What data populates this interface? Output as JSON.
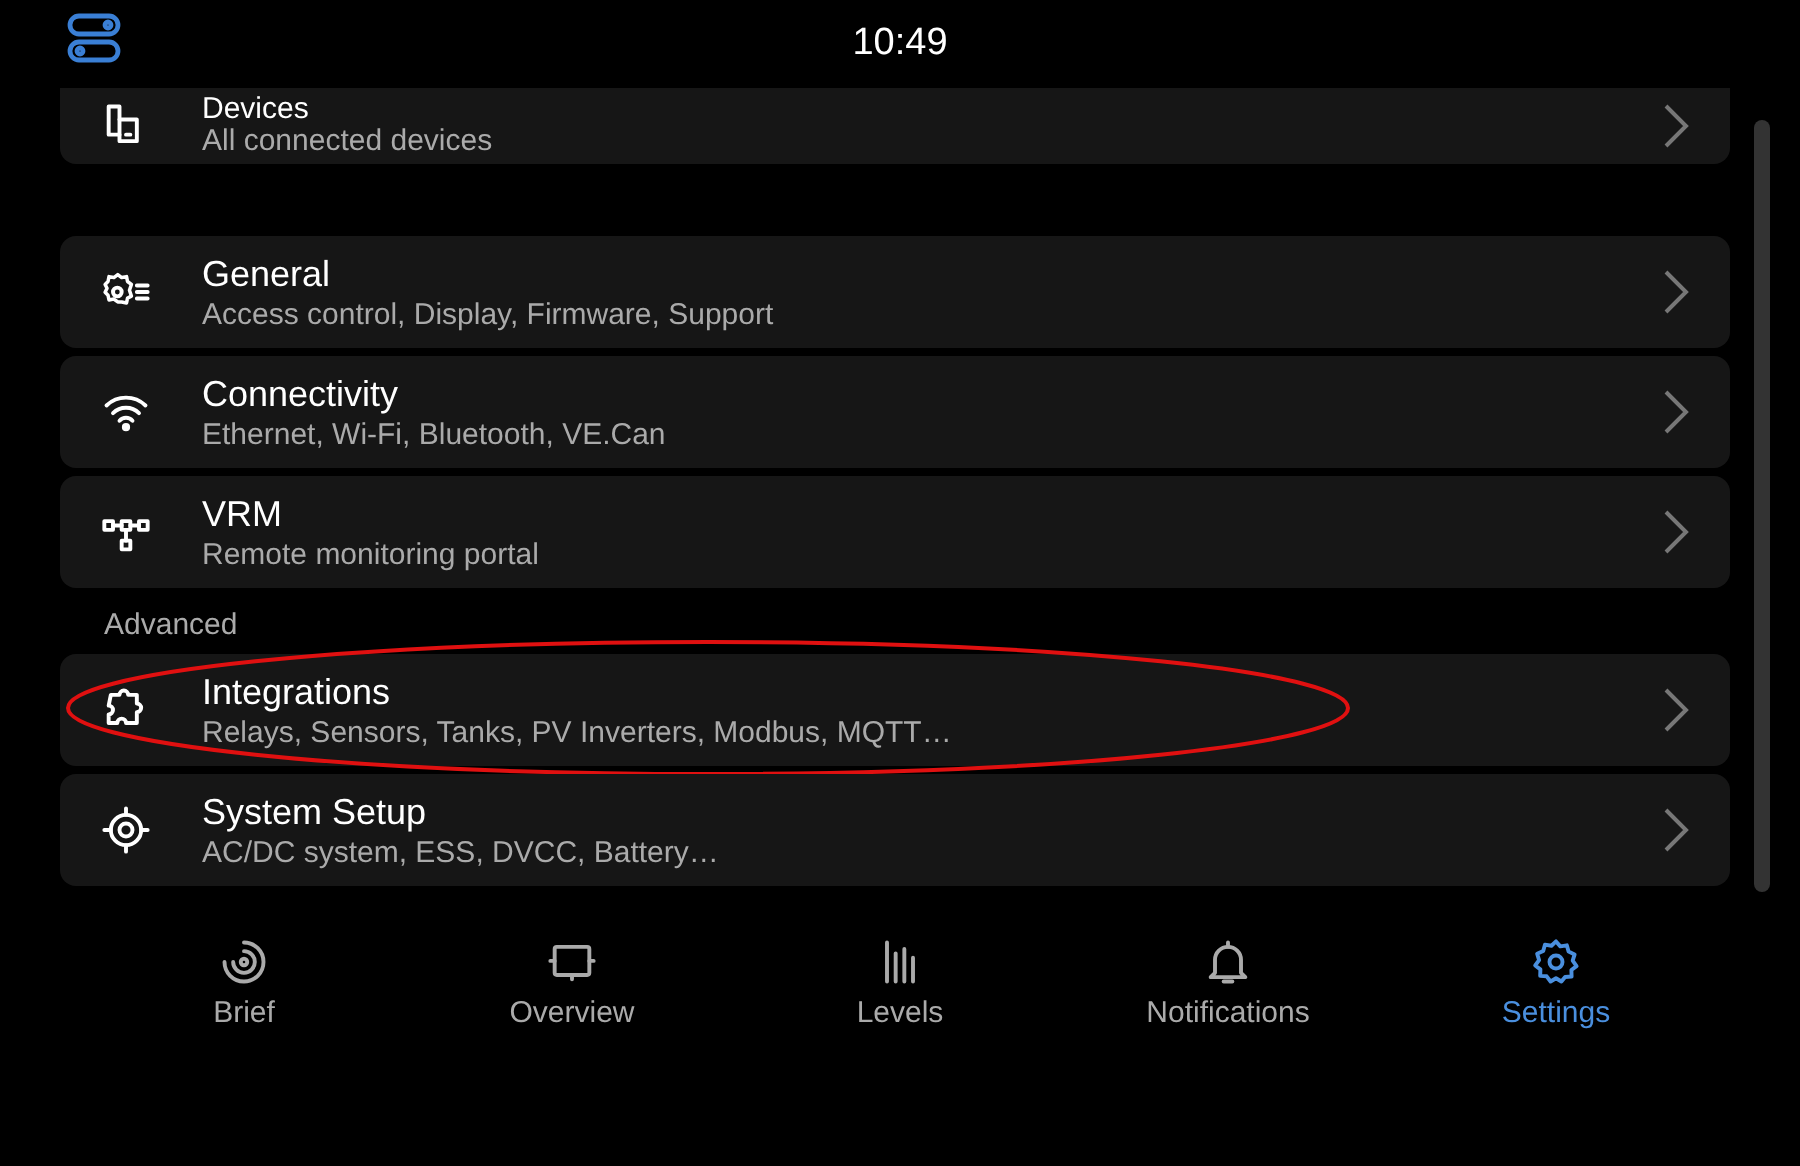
{
  "status_bar": {
    "time": "10:49"
  },
  "sections": [
    {
      "items": [
        {
          "kind": "devices",
          "title": "Devices",
          "subtitle": "All connected devices",
          "highlighted": false
        }
      ]
    },
    {
      "items": [
        {
          "kind": "general",
          "title": "General",
          "subtitle": "Access control, Display, Firmware, Support",
          "highlighted": false
        },
        {
          "kind": "wifi",
          "title": "Connectivity",
          "subtitle": "Ethernet, Wi-Fi, Bluetooth, VE.Can",
          "highlighted": false
        },
        {
          "kind": "network",
          "title": "VRM",
          "subtitle": "Remote monitoring portal",
          "highlighted": false
        }
      ]
    },
    {
      "header": "Advanced",
      "items": [
        {
          "kind": "puzzle",
          "title": "Integrations",
          "subtitle": "Relays, Sensors, Tanks, PV Inverters, Modbus, MQTT…",
          "highlighted": true
        },
        {
          "kind": "target",
          "title": "System Setup",
          "subtitle": "AC/DC system, ESS, DVCC, Battery…",
          "highlighted": false
        }
      ]
    }
  ],
  "nav": [
    {
      "kind": "brief",
      "label": "Brief",
      "selected": false
    },
    {
      "kind": "overview",
      "label": "Overview",
      "selected": false
    },
    {
      "kind": "levels",
      "label": "Levels",
      "selected": false
    },
    {
      "kind": "bell",
      "label": "Notifications",
      "selected": false
    },
    {
      "kind": "gear",
      "label": "Settings",
      "selected": true
    }
  ]
}
